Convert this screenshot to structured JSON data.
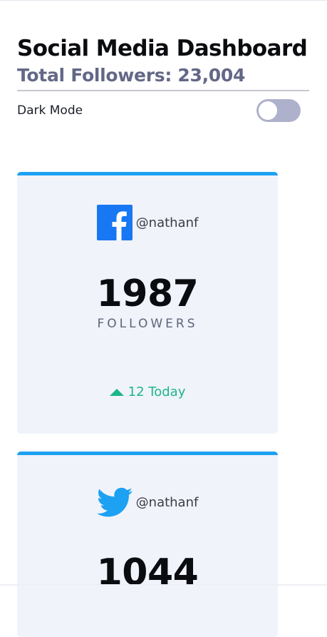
{
  "header": {
    "title": "Social Media Dashboard",
    "total_followers": "Total Followers: 23,004"
  },
  "dark_mode": {
    "label": "Dark Mode",
    "enabled": false
  },
  "cards": [
    {
      "network": "Facebook",
      "icon": "facebook-icon",
      "handle": "@nathanf",
      "count": "1987",
      "count_label": "FOLLOWERS",
      "today_text": "12 Today",
      "today_trend": "up",
      "accent": "#1ea1f2"
    },
    {
      "network": "Twitter",
      "icon": "twitter-icon",
      "handle": "@nathanf",
      "count": "1044",
      "accent": "#1ea1f2"
    }
  ],
  "colors": {
    "card_bg": "#f0f3fa",
    "positive": "#1eb589",
    "toggle_track": "#aeb1cb",
    "muted_text": "#636887"
  }
}
